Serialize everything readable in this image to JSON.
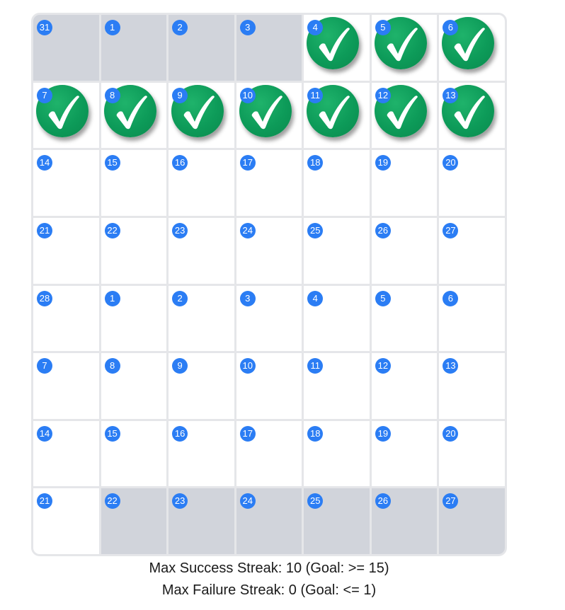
{
  "calendar": {
    "cells": [
      {
        "day": "31",
        "outside": true,
        "checked": false
      },
      {
        "day": "1",
        "outside": true,
        "checked": false
      },
      {
        "day": "2",
        "outside": true,
        "checked": false
      },
      {
        "day": "3",
        "outside": true,
        "checked": false
      },
      {
        "day": "4",
        "outside": false,
        "checked": true
      },
      {
        "day": "5",
        "outside": false,
        "checked": true
      },
      {
        "day": "6",
        "outside": false,
        "checked": true
      },
      {
        "day": "7",
        "outside": false,
        "checked": true
      },
      {
        "day": "8",
        "outside": false,
        "checked": true
      },
      {
        "day": "9",
        "outside": false,
        "checked": true
      },
      {
        "day": "10",
        "outside": false,
        "checked": true
      },
      {
        "day": "11",
        "outside": false,
        "checked": true
      },
      {
        "day": "12",
        "outside": false,
        "checked": true
      },
      {
        "day": "13",
        "outside": false,
        "checked": true
      },
      {
        "day": "14",
        "outside": false,
        "checked": false
      },
      {
        "day": "15",
        "outside": false,
        "checked": false
      },
      {
        "day": "16",
        "outside": false,
        "checked": false
      },
      {
        "day": "17",
        "outside": false,
        "checked": false
      },
      {
        "day": "18",
        "outside": false,
        "checked": false
      },
      {
        "day": "19",
        "outside": false,
        "checked": false
      },
      {
        "day": "20",
        "outside": false,
        "checked": false
      },
      {
        "day": "21",
        "outside": false,
        "checked": false
      },
      {
        "day": "22",
        "outside": false,
        "checked": false
      },
      {
        "day": "23",
        "outside": false,
        "checked": false
      },
      {
        "day": "24",
        "outside": false,
        "checked": false
      },
      {
        "day": "25",
        "outside": false,
        "checked": false
      },
      {
        "day": "26",
        "outside": false,
        "checked": false
      },
      {
        "day": "27",
        "outside": false,
        "checked": false
      },
      {
        "day": "28",
        "outside": false,
        "checked": false
      },
      {
        "day": "1",
        "outside": false,
        "checked": false
      },
      {
        "day": "2",
        "outside": false,
        "checked": false
      },
      {
        "day": "3",
        "outside": false,
        "checked": false
      },
      {
        "day": "4",
        "outside": false,
        "checked": false
      },
      {
        "day": "5",
        "outside": false,
        "checked": false
      },
      {
        "day": "6",
        "outside": false,
        "checked": false
      },
      {
        "day": "7",
        "outside": false,
        "checked": false
      },
      {
        "day": "8",
        "outside": false,
        "checked": false
      },
      {
        "day": "9",
        "outside": false,
        "checked": false
      },
      {
        "day": "10",
        "outside": false,
        "checked": false
      },
      {
        "day": "11",
        "outside": false,
        "checked": false
      },
      {
        "day": "12",
        "outside": false,
        "checked": false
      },
      {
        "day": "13",
        "outside": false,
        "checked": false
      },
      {
        "day": "14",
        "outside": false,
        "checked": false
      },
      {
        "day": "15",
        "outside": false,
        "checked": false
      },
      {
        "day": "16",
        "outside": false,
        "checked": false
      },
      {
        "day": "17",
        "outside": false,
        "checked": false
      },
      {
        "day": "18",
        "outside": false,
        "checked": false
      },
      {
        "day": "19",
        "outside": false,
        "checked": false
      },
      {
        "day": "20",
        "outside": false,
        "checked": false
      },
      {
        "day": "21",
        "outside": false,
        "checked": false
      },
      {
        "day": "22",
        "outside": true,
        "checked": false
      },
      {
        "day": "23",
        "outside": true,
        "checked": false
      },
      {
        "day": "24",
        "outside": true,
        "checked": false
      },
      {
        "day": "25",
        "outside": true,
        "checked": false
      },
      {
        "day": "26",
        "outside": true,
        "checked": false
      },
      {
        "day": "27",
        "outside": true,
        "checked": false
      }
    ],
    "check_icon": "checkmark-icon",
    "colors": {
      "badge": "#2b7df4",
      "check": "#0d9b59",
      "outside_cell": "#d1d4db",
      "grid_line": "#e5e6e9"
    }
  },
  "summary": {
    "success_streak": "Max Success Streak: 10 (Goal: >= 15)",
    "failure_streak": "Max Failure Streak: 0 (Goal: <= 1)"
  }
}
